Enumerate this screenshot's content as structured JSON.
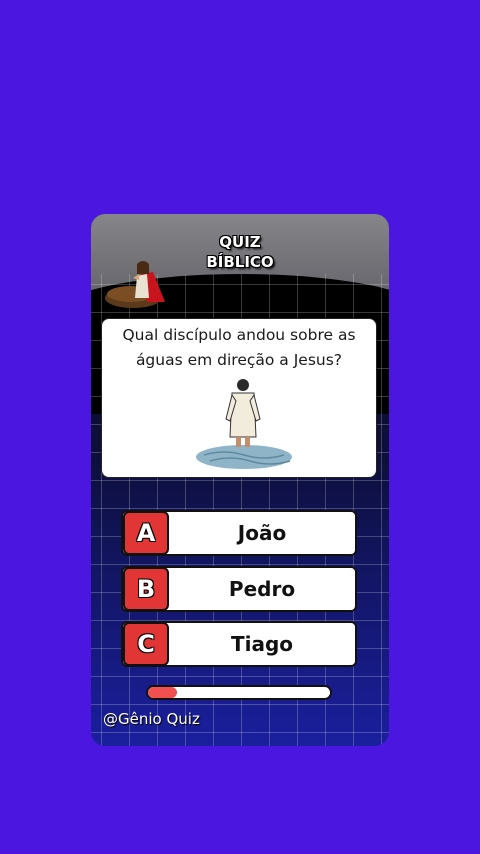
{
  "header": {
    "title_line1": "QUIZ",
    "title_line2": "BÍBLICO"
  },
  "question": {
    "text": "Qual discípulo andou sobre as águas em direção a Jesus?"
  },
  "answers": [
    {
      "letter": "A",
      "label": "João"
    },
    {
      "letter": "B",
      "label": "Pedro"
    },
    {
      "letter": "C",
      "label": "Tiago"
    }
  ],
  "progress": {
    "fraction": 0.16
  },
  "footer": {
    "handle": "@Gênio Quiz"
  },
  "colors": {
    "background": "#4b17e0",
    "accent_red": "#e23535",
    "progress_fill": "#f05050"
  },
  "icons": {
    "header_illustration": "praying-figure-icon",
    "question_illustration": "walking-on-water-icon"
  }
}
